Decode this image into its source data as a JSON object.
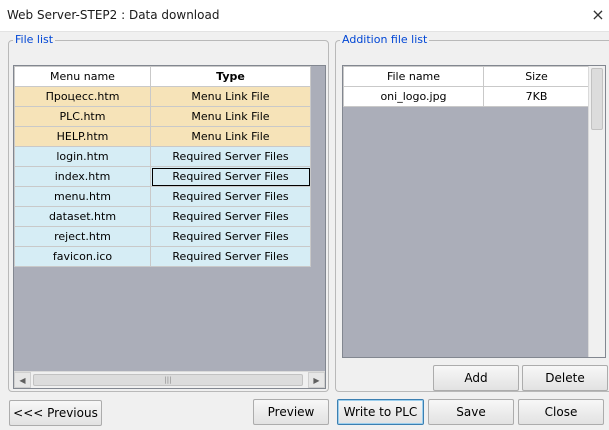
{
  "window": {
    "title": "Web Server-STEP2 : Data download",
    "close_glyph": "×"
  },
  "file_list": {
    "legend": "File list",
    "columns": [
      "Menu name",
      "Type"
    ],
    "rows": [
      {
        "name": "Процесс.htm",
        "type": "Menu Link File",
        "kind": "menu"
      },
      {
        "name": "PLC.htm",
        "type": "Menu Link File",
        "kind": "menu"
      },
      {
        "name": "HELP.htm",
        "type": "Menu Link File",
        "kind": "menu"
      },
      {
        "name": "login.htm",
        "type": "Required Server Files",
        "kind": "req"
      },
      {
        "name": "index.htm",
        "type": "Required Server Files",
        "kind": "req",
        "selected": true
      },
      {
        "name": "menu.htm",
        "type": "Required Server Files",
        "kind": "req"
      },
      {
        "name": "dataset.htm",
        "type": "Required Server Files",
        "kind": "req"
      },
      {
        "name": "reject.htm",
        "type": "Required Server Files",
        "kind": "req"
      },
      {
        "name": "favicon.ico",
        "type": "Required Server Files",
        "kind": "req"
      }
    ]
  },
  "addition_list": {
    "legend": "Addition file list",
    "columns": [
      "File name",
      "Size"
    ],
    "rows": [
      {
        "name": "oni_logo.jpg",
        "size": "7KB"
      }
    ]
  },
  "buttons": {
    "previous": "<<< Previous",
    "preview": "Preview",
    "write": "Write to PLC",
    "save": "Save",
    "close": "Close",
    "add": "Add",
    "delete": "Delete"
  },
  "icons": {
    "scroll_left": "left-arrow-icon",
    "scroll_right": "right-arrow-icon",
    "close": "close-icon"
  },
  "colors": {
    "menu_row": "#f6e3b8",
    "required_row": "#d6edf5",
    "legend_text": "#0046d5",
    "grid_empty": "#abaeb9"
  }
}
